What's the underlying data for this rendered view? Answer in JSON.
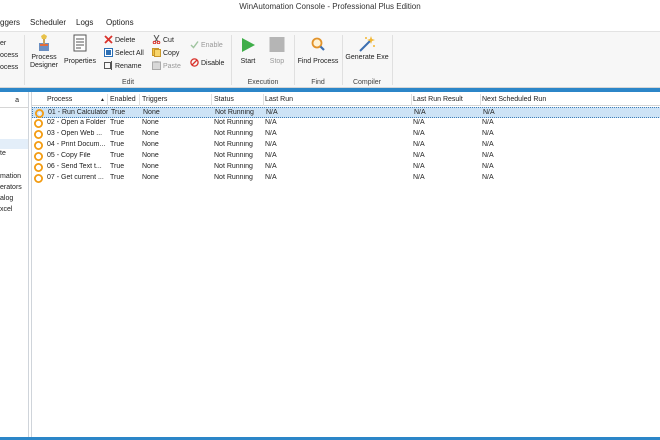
{
  "window": {
    "title": "WinAutomation Console - Professional Plus Edition"
  },
  "menu": [
    "ggers",
    "Scheduler",
    "Logs",
    "Options"
  ],
  "ribbon": {
    "left_partial": [
      "er",
      "ocess",
      "ocess"
    ],
    "process_designer": "Process Designer",
    "properties": "Properties",
    "delete": "Delete",
    "select_all": "Select All",
    "rename": "Rename",
    "cut": "Cut",
    "copy": "Copy",
    "paste": "Paste",
    "enable": "Enable",
    "disable": "Disable",
    "start": "Start",
    "stop": "Stop",
    "find_process": "Find Process",
    "generate_exe": "Generate Exe",
    "groups": {
      "edit": "Edit",
      "execution": "Execution",
      "find": "Find",
      "compiler": "Compiler"
    }
  },
  "left_panel": {
    "header_partial": "a",
    "items": [
      "te",
      "mation",
      "erators",
      "alog",
      "xcel"
    ]
  },
  "grid": {
    "columns": [
      "Process",
      "Enabled",
      "Triggers",
      "Status",
      "Last Run",
      "Last Run Result",
      "Next Scheduled Run"
    ],
    "sort_indicator": "▲",
    "rows": [
      {
        "process": "01 - Run Calculator",
        "enabled": "True",
        "triggers": "None",
        "status": "Not Running",
        "last_run": "N/A",
        "last_run_result": "N/A",
        "next_run": "N/A"
      },
      {
        "process": "02 - Open a Folder",
        "enabled": "True",
        "triggers": "None",
        "status": "Not Running",
        "last_run": "N/A",
        "last_run_result": "N/A",
        "next_run": "N/A"
      },
      {
        "process": "03 - Open Web ...",
        "enabled": "True",
        "triggers": "None",
        "status": "Not Running",
        "last_run": "N/A",
        "last_run_result": "N/A",
        "next_run": "N/A"
      },
      {
        "process": "04 - Print Docum...",
        "enabled": "True",
        "triggers": "None",
        "status": "Not Running",
        "last_run": "N/A",
        "last_run_result": "N/A",
        "next_run": "N/A"
      },
      {
        "process": "05 - Copy File",
        "enabled": "True",
        "triggers": "None",
        "status": "Not Running",
        "last_run": "N/A",
        "last_run_result": "N/A",
        "next_run": "N/A"
      },
      {
        "process": "06 - Send Text t...",
        "enabled": "True",
        "triggers": "None",
        "status": "Not Running",
        "last_run": "N/A",
        "last_run_result": "N/A",
        "next_run": "N/A"
      },
      {
        "process": "07 - Get current ...",
        "enabled": "True",
        "triggers": "None",
        "status": "Not Running",
        "last_run": "N/A",
        "last_run_result": "N/A",
        "next_run": "N/A"
      }
    ]
  },
  "colors": {
    "accent": "#2c86c8",
    "selection": "#cde3f6",
    "process_icon": "#f39c12",
    "start_icon": "#3fae49"
  },
  "icons": [
    "process-designer-icon",
    "properties-icon",
    "delete-icon",
    "select-all-icon",
    "rename-icon",
    "cut-icon",
    "copy-icon",
    "paste-icon",
    "enable-icon",
    "disable-icon",
    "start-icon",
    "stop-icon",
    "find-process-icon",
    "generate-exe-icon",
    "process-icon"
  ]
}
